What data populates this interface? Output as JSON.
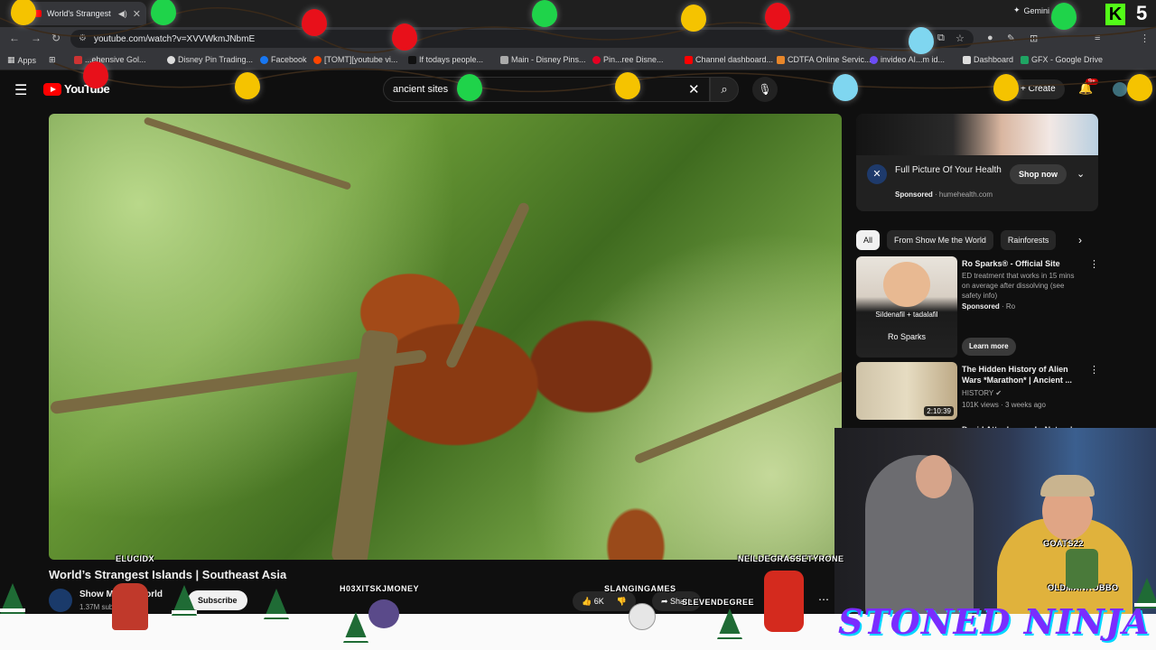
{
  "browser": {
    "tab_title": "World's Strangest Isla...",
    "url": "youtube.com/watch?v=XVVWkmJNbmE",
    "gemini_label": "Gemini",
    "kick_letter": "K",
    "kick_number": "5"
  },
  "bookmarks": [
    {
      "label": "Apps"
    },
    {
      "label": "...ehensive Gol..."
    },
    {
      "label": "Disney Pin Trading..."
    },
    {
      "label": "Facebook"
    },
    {
      "label": "[TOMT][youtube vi..."
    },
    {
      "label": "If todays people..."
    },
    {
      "label": "Main - Disney Pins..."
    },
    {
      "label": "Pin...ree Disne..."
    },
    {
      "label": "Channel dashboard..."
    },
    {
      "label": "CDTFA Online Servic..."
    },
    {
      "label": "invideo AI...m id..."
    },
    {
      "label": "Dashboard"
    },
    {
      "label": "GFX - Google Drive"
    }
  ],
  "youtube": {
    "logo_text": "YouTube",
    "search_value": "ancient sites",
    "create_label": "Create",
    "notif_count": "9+"
  },
  "video": {
    "title": "World’s Strangest Islands | Southeast Asia",
    "channel": "Show Me the World",
    "subs": "1.37M sub...",
    "subscribe_label": "Subscribe",
    "likes": "6K",
    "share_label": "Share"
  },
  "ad": {
    "title": "Full Picture Of Your Health",
    "sponsored": "Sponsored",
    "domain": "humehealth.com",
    "shop_label": "Shop now"
  },
  "chips": [
    {
      "label": "All"
    },
    {
      "label": "From Show Me the World"
    },
    {
      "label": "Rainforests"
    }
  ],
  "recs": [
    {
      "title": "Ro Sparks® - Official Site",
      "desc": "ED treatment that works in 15 mins on average after dissolving (see safety info)",
      "meta_sponsored": "Sponsored",
      "meta_source": "Ro",
      "button": "Learn more",
      "thumb_label": "Ro Sparks",
      "thumb_label2": "Sildenafil + tadalafil"
    },
    {
      "title": "The Hidden History of Alien Wars *Marathon* | Ancient ...",
      "channel": "HISTORY",
      "meta": "101K views · 3 weeks ago",
      "duration": "2:10:39"
    },
    {
      "title": "David Attenborough: Nature's..."
    }
  ],
  "overlay": {
    "viewer_tags": [
      "ELUCIDX",
      "NEILDEGRASSETYRONE",
      "H03XITSKJMONEY",
      "SLANGINGAMES",
      "GOATS22",
      "SLEVENDEGREE",
      "OLDMANROBBO"
    ],
    "banner": "STONED NINJA"
  },
  "colors": {
    "youtube_red": "#ff0000",
    "banner_purple": "#7a2cff",
    "kick_green": "#53fc18"
  }
}
